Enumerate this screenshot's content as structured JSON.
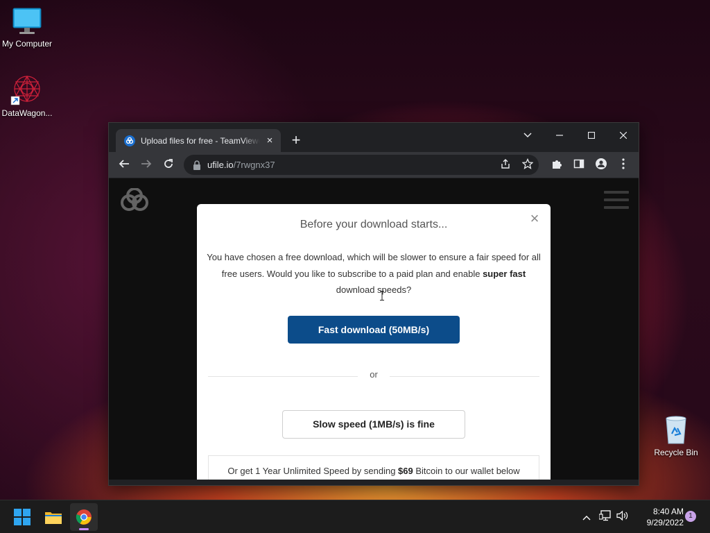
{
  "desktop": {
    "icons": [
      {
        "label": "My Computer",
        "icon": "monitor-icon"
      },
      {
        "label": "DataWagon...",
        "icon": "datawagon-shortcut-icon"
      },
      {
        "label": "Recycle Bin",
        "icon": "recycle-bin-icon"
      }
    ]
  },
  "browser": {
    "tab": {
      "title": "Upload files for free - TeamViewer",
      "favicon": "ufile-logo-icon",
      "close": "×"
    },
    "new_tab": "+",
    "window_controls": {
      "tab_search": "⌄",
      "minimize": "—",
      "maximize": "☐",
      "close": "✕"
    },
    "toolbar": {
      "back": "←",
      "forward": "→",
      "reload": "↻"
    },
    "url": {
      "host": "ufile.io",
      "path": "/7rwgnx37"
    }
  },
  "page": {
    "modal": {
      "title": "Before your download starts...",
      "close": "×",
      "body_part1": "You have chosen a free download, which will be slower to ensure a fair speed for all free users. Would you like to subscribe to a paid plan and enable ",
      "body_bold": "super fast",
      "body_part2": " download speeds?",
      "fast_button": "Fast download (50MB/s)",
      "or": "or",
      "slow_button": "Slow speed (1MB/s) is fine",
      "bitcoin_part1": "Or get 1 Year Unlimited Speed by sending ",
      "bitcoin_amount": "$69",
      "bitcoin_part2": " Bitcoin to our wallet below"
    }
  },
  "taskbar": {
    "clock_time": "8:40 AM",
    "clock_date": "9/29/2022",
    "notification_count": "1"
  },
  "colors": {
    "fast_button": "#0c4c8a",
    "chrome_dark": "#202124",
    "chrome_toolbar": "#35363a",
    "badge": "#c8a2e8"
  }
}
